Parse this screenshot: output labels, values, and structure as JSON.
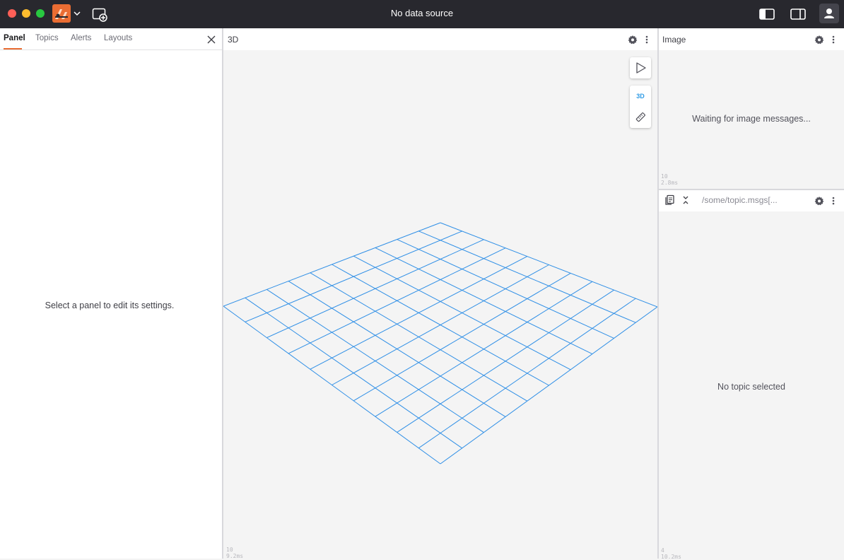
{
  "app": {
    "title": "No data source"
  },
  "sidebar": {
    "tabs": [
      {
        "label": "Panel",
        "active": true
      },
      {
        "label": "Topics",
        "active": false
      },
      {
        "label": "Alerts",
        "active": false
      },
      {
        "label": "Layouts",
        "active": false
      }
    ],
    "empty_message": "Select a panel to edit its settings."
  },
  "panel_3d": {
    "title": "3D",
    "toolbar": {
      "mode_label": "3D"
    },
    "stats": {
      "fps": "10",
      "frame_time": "9.2ms"
    }
  },
  "panel_image": {
    "title": "Image",
    "message": "Waiting for image messages...",
    "stats": {
      "fps": "10",
      "frame_time": "2.8ms"
    }
  },
  "panel_raw": {
    "topic_placeholder": "/some/topic.msgs[...",
    "message": "No topic selected",
    "stats": {
      "fps": "4",
      "frame_time": "10.2ms"
    }
  },
  "colors": {
    "titlebar": "#28282e",
    "accent": "#ea6d33",
    "grid": "#2f8fe6",
    "panel_bg": "#f4f4f4"
  }
}
